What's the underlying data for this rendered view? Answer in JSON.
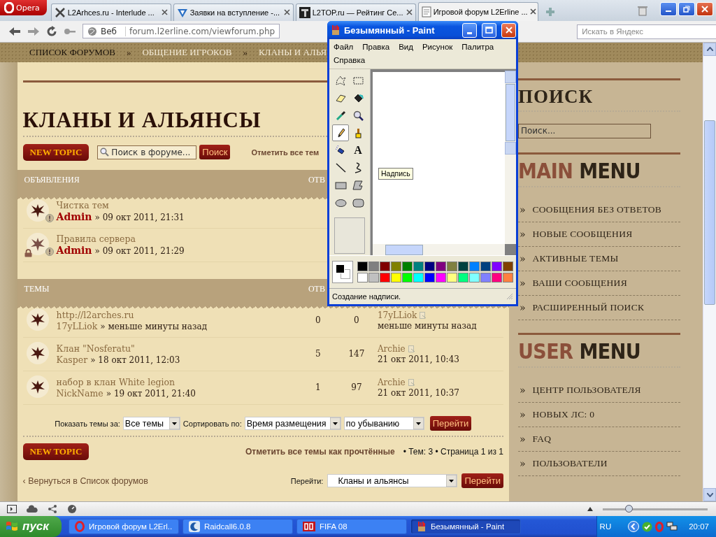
{
  "browser": {
    "opera_button": "Opera",
    "tabs": [
      {
        "title": "L2Arhces.ru - Interlude ...",
        "selected": false
      },
      {
        "title": "Заявки на вступление -...",
        "selected": false
      },
      {
        "title": "L2TOP.ru — Рейтинг Се...",
        "selected": false
      },
      {
        "title": "Игровой форум L2Erline ...",
        "selected": true
      }
    ],
    "address": {
      "scope": "Веб",
      "url": "forum.l2erline.com/viewforum.php"
    },
    "search": {
      "placeholder": "Искать в Яндекс"
    }
  },
  "page": {
    "breadcrumb": [
      {
        "kind": "link",
        "text": "СПИСОК ФОРУМОВ"
      },
      {
        "kind": "separator",
        "text": "»"
      },
      {
        "kind": "link",
        "text": "ОБЩЕНИЕ ИГРОКОВ"
      },
      {
        "kind": "separator",
        "text": "»"
      },
      {
        "kind": "link",
        "text": "КЛАНЫ И АЛЬЯ"
      }
    ],
    "forum": {
      "title": "КЛАНЫ И АЛЬЯНСЫ",
      "new_topic": "NEW TOPIC",
      "search": {
        "placeholder": "Поиск в форуме...",
        "button": "Поиск"
      },
      "mark_read": "Отметить все тем",
      "sections": [
        {
          "kind": "announcements",
          "title": "ОБЪЯВЛЕНИЯ",
          "column": "ОТВ",
          "rows": [
            {
              "title": "Чистка тем",
              "author": "Admin",
              "byline": "» 09 окт 2011, 21:31",
              "locked": false
            },
            {
              "title": "Правила сервера",
              "author": "Admin",
              "byline": "» 09 окт 2011, 21:29",
              "locked": true
            }
          ]
        },
        {
          "kind": "topics",
          "title": "ТЕМЫ",
          "column": "ОТВ",
          "rows": [
            {
              "title": "http://l2arches.ru",
              "author": "17yLLiok",
              "byline": "» меньше минуты назад",
              "locked": false,
              "replies": "0",
              "views": "0",
              "last_author": "17yLLiok",
              "last_date": "меньше минуты назад"
            },
            {
              "title": "Клан \"Nosferatu\"",
              "author": "Kasper",
              "byline": "» 18 окт 2011, 12:03",
              "locked": false,
              "replies": "5",
              "views": "147",
              "last_author": "Archie",
              "last_date": "21 окт 2011, 10:43"
            },
            {
              "title": "набор в клан White legion",
              "author": "NickName",
              "byline": "» 19 окт 2011, 21:40",
              "locked": false,
              "replies": "1",
              "views": "97",
              "last_author": "Archie",
              "last_date": "21 окт 2011, 10:37"
            }
          ]
        }
      ],
      "filters": {
        "show_label": "Показать темы за:",
        "show_value": "Все темы",
        "sort_label": "Сортировать по:",
        "sort_value": "Время размещения",
        "order_value": "по убыванию",
        "button": "Перейти"
      },
      "footer": {
        "new_topic": "NEW TOPIC",
        "mark_read": "Отметить все темы как прочтённые",
        "stats": "• Тем: 3 • Страница 1 из 1",
        "back": "‹ Вернуться в Список форумов",
        "jump_label": "Перейти:",
        "jump_value": "Кланы и альянсы",
        "jump_button": "Перейти"
      }
    },
    "sidebar": {
      "search_title": "ПОИСК",
      "search_placeholder": "Поиск...",
      "menus": [
        {
          "accent": "MAIN",
          "rest": "MENU",
          "items": [
            {
              "marker": "»",
              "label": "СООБЩЕНИЯ БЕЗ ОТВЕТОВ"
            },
            {
              "marker": "»",
              "label": "НОВЫЕ СООБЩЕНИЯ"
            },
            {
              "marker": "»",
              "label": "АКТИВНЫЕ ТЕМЫ"
            },
            {
              "marker": "»",
              "label": "ВАШИ СООБЩЕНИЯ"
            },
            {
              "marker": "»",
              "label": "РАСШИРЕННЫЙ ПОИСК"
            }
          ]
        },
        {
          "accent": "USER",
          "rest": "MENU",
          "items": [
            {
              "marker": "»",
              "label": "ЦЕНТР ПОЛЬЗОВАТЕЛЯ"
            },
            {
              "marker": "»",
              "label": "НОВЫХ ЛС: 0"
            },
            {
              "marker": "»",
              "label": "FAQ"
            },
            {
              "marker": "»",
              "label": "ПОЛЬЗОВАТЕЛИ"
            }
          ]
        }
      ]
    }
  },
  "paint": {
    "title": "Безымянный - Paint",
    "menu": [
      "Файл",
      "Правка",
      "Вид",
      "Рисунок",
      "Палитра",
      "Справка"
    ],
    "tools": [
      {
        "kind": "free-select",
        "selected": false
      },
      {
        "kind": "select",
        "selected": false
      },
      {
        "kind": "eraser",
        "selected": false
      },
      {
        "kind": "fill",
        "selected": false
      },
      {
        "kind": "picker",
        "selected": false
      },
      {
        "kind": "magnifier",
        "selected": false
      },
      {
        "kind": "pencil",
        "selected": true
      },
      {
        "kind": "brush",
        "selected": false
      },
      {
        "kind": "airbrush",
        "selected": false
      },
      {
        "kind": "text",
        "glyph": "A",
        "selected": false
      },
      {
        "kind": "line",
        "selected": false
      },
      {
        "kind": "curve",
        "selected": false
      },
      {
        "kind": "rectangle",
        "selected": false
      },
      {
        "kind": "polygon",
        "selected": false
      },
      {
        "kind": "ellipse",
        "selected": false
      },
      {
        "kind": "rounded-rectangle",
        "selected": false
      }
    ],
    "tooltip": "Надпись",
    "palette": [
      {
        "color": "#000000"
      },
      {
        "color": "#808080"
      },
      {
        "color": "#800000"
      },
      {
        "color": "#808000"
      },
      {
        "color": "#008000"
      },
      {
        "color": "#008080"
      },
      {
        "color": "#000080"
      },
      {
        "color": "#800080"
      },
      {
        "color": "#808040"
      },
      {
        "color": "#004040"
      },
      {
        "color": "#0080ff"
      },
      {
        "color": "#004080"
      },
      {
        "color": "#8000ff"
      },
      {
        "color": "#804000"
      },
      {
        "color": "#ffffff"
      },
      {
        "color": "#c0c0c0"
      },
      {
        "color": "#ff0000"
      },
      {
        "color": "#ffff00"
      },
      {
        "color": "#00ff00"
      },
      {
        "color": "#00ffff"
      },
      {
        "color": "#0000ff"
      },
      {
        "color": "#ff00ff"
      },
      {
        "color": "#ffff80"
      },
      {
        "color": "#00ff80"
      },
      {
        "color": "#80ffff"
      },
      {
        "color": "#8080ff"
      },
      {
        "color": "#ff0080"
      },
      {
        "color": "#ff8040"
      }
    ],
    "status": "Создание надписи."
  },
  "browser_status": {
    "zoom": {
      "level": 0.25
    }
  },
  "taskbar": {
    "start": "пуск",
    "tasks": [
      {
        "title": "Игровой форум L2Erl...",
        "selected": false
      },
      {
        "title": "Raidcall6.0.8",
        "selected": false
      },
      {
        "title": "FIFA 08",
        "selected": false
      },
      {
        "title": "Безымянный - Paint",
        "selected": true
      }
    ],
    "language": "RU",
    "clock": "20:07"
  }
}
